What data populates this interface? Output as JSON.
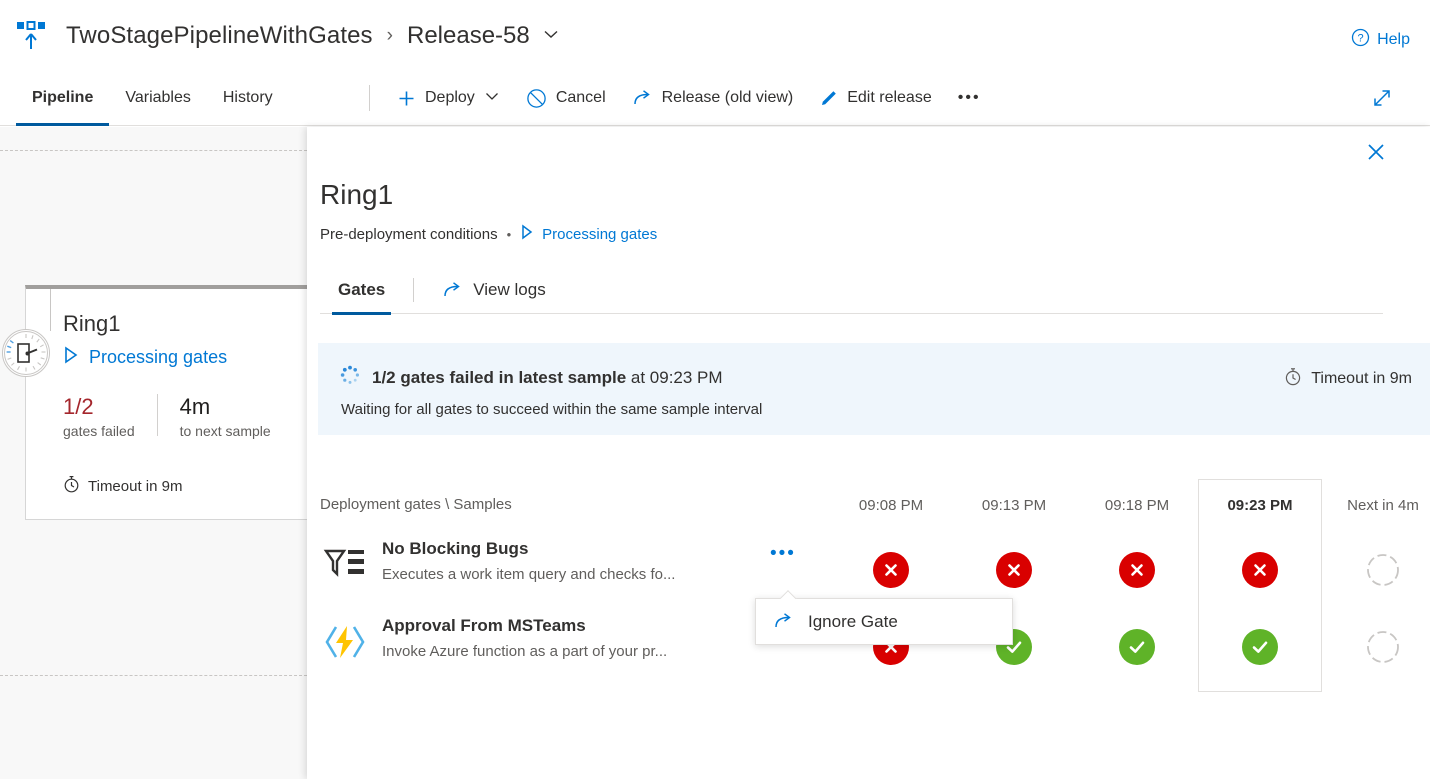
{
  "header": {
    "pipeline_icon": "pipeline-icon",
    "project": "TwoStagePipelineWithGates",
    "separator": "›",
    "release": "Release-58",
    "release_caret_icon": "chevron-down-icon",
    "help_label": "Help",
    "help_icon": "question-circle-icon"
  },
  "commandbar": {
    "tabs": [
      {
        "label": "Pipeline",
        "active": true
      },
      {
        "label": "Variables",
        "active": false
      },
      {
        "label": "History",
        "active": false
      }
    ],
    "commands": [
      {
        "label": "Deploy",
        "icon": "plus-icon",
        "caret": "chevron-down-icon"
      },
      {
        "label": "Cancel",
        "icon": "block-icon"
      },
      {
        "label": "Release (old view)",
        "icon": "external-arrow-icon"
      },
      {
        "label": "Edit release",
        "icon": "pencil-icon"
      },
      {
        "label": "•••",
        "icon": "more-icon"
      }
    ],
    "expand_icon": "expand-diagonal-icon"
  },
  "stage_card": {
    "badge_icon": "gate-barrier-icon",
    "title": "Ring1",
    "status_icon": "play-triangle-icon",
    "status_label": "Processing gates",
    "metrics": [
      {
        "value": "1/2",
        "label": "gates failed",
        "state": "fail"
      },
      {
        "value": "4m",
        "label": "to next sample",
        "state": "normal"
      }
    ],
    "timeout_icon": "stopwatch-icon",
    "timeout_label": "Timeout in 9m"
  },
  "panel": {
    "close_icon": "close-icon",
    "title": "Ring1",
    "subtitle": "Pre-deployment conditions",
    "sub_dot": "•",
    "sub_status_icon": "play-triangle-icon",
    "sub_status_label": "Processing gates",
    "tabs": [
      {
        "label": "Gates",
        "active": true,
        "icon": null
      },
      {
        "label": "View logs",
        "active": false,
        "icon": "external-arrow-icon"
      }
    ],
    "banner": {
      "spinner_icon": "loading-spinner-icon",
      "bold_text": "1/2 gates failed in latest sample",
      "rest_text": " at 09:23 PM",
      "detail": "Waiting for all gates to succeed within the same sample interval",
      "timeout_icon": "stopwatch-icon",
      "timeout_label": "Timeout in 9m"
    },
    "table": {
      "row_header": "Deployment gates \\ Samples",
      "columns": [
        {
          "label": "09:08 PM",
          "selected": false
        },
        {
          "label": "09:13 PM",
          "selected": false
        },
        {
          "label": "09:18 PM",
          "selected": false
        },
        {
          "label": "09:23 PM",
          "selected": true
        },
        {
          "label": "Next in 4m",
          "selected": false
        }
      ],
      "rows": [
        {
          "icon": "work-item-query-icon",
          "name": "No Blocking Bugs",
          "description": "Executes a work item query and checks fo...",
          "more_icon": "•••",
          "statuses": [
            "fail",
            "fail",
            "fail",
            "fail",
            "pending"
          ]
        },
        {
          "icon": "azure-function-icon",
          "name": "Approval From MSTeams",
          "description": "Invoke Azure function as a part of your pr...",
          "more_icon": null,
          "statuses": [
            "fail",
            "pass",
            "pass",
            "pass",
            "pending"
          ]
        }
      ]
    }
  },
  "callout": {
    "icon": "external-arrow-icon",
    "label": "Ignore Gate"
  },
  "colors": {
    "accent": "#0078d4",
    "accent_dark": "#005a9e",
    "fail_red": "#d90000",
    "fail_text_red": "#a4262c",
    "pass_green": "#5fb328",
    "banner_bg": "#eff6fc",
    "pending_gray": "#c8c6c4"
  }
}
